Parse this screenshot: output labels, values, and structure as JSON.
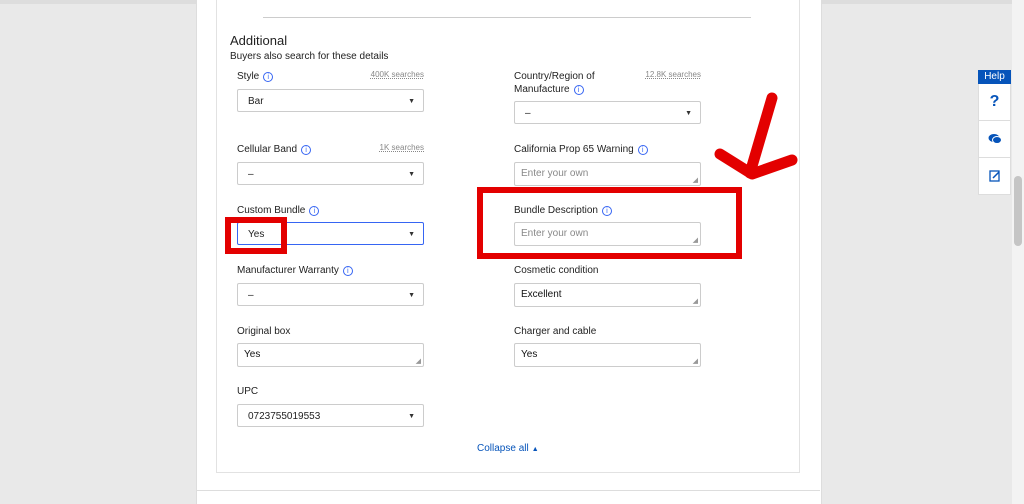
{
  "section": {
    "title": "Additional",
    "subtitle": "Buyers also search for these details"
  },
  "fields": {
    "style": {
      "label": "Style",
      "searches": "400K searches",
      "value": "Bar"
    },
    "country": {
      "label_line1": "Country/Region of",
      "label_line2": "Manufacture",
      "searches": "12.8K searches",
      "value": "–"
    },
    "cellular_band": {
      "label": "Cellular Band",
      "searches": "1K searches",
      "value": "–"
    },
    "prop65": {
      "label": "California Prop 65 Warning",
      "placeholder": "Enter your own"
    },
    "custom_bundle": {
      "label": "Custom Bundle",
      "value": "Yes"
    },
    "bundle_description": {
      "label": "Bundle Description",
      "placeholder": "Enter your own"
    },
    "manufacturer_warranty": {
      "label": "Manufacturer Warranty",
      "value": "–"
    },
    "cosmetic_condition": {
      "label": "Cosmetic condition",
      "value": "Excellent"
    },
    "original_box": {
      "label": "Original box",
      "value": "Yes"
    },
    "charger_cable": {
      "label": "Charger and cable",
      "value": "Yes"
    },
    "upc": {
      "label": "UPC",
      "value": "0723755019553"
    }
  },
  "collapse_label": "Collapse all",
  "help": {
    "tab_label": "Help",
    "icons": [
      "question-icon",
      "chat-icon",
      "feedback-icon"
    ]
  },
  "colors": {
    "accent": "#3665f3",
    "link": "#0654ba",
    "annotation_red": "#e30000"
  }
}
